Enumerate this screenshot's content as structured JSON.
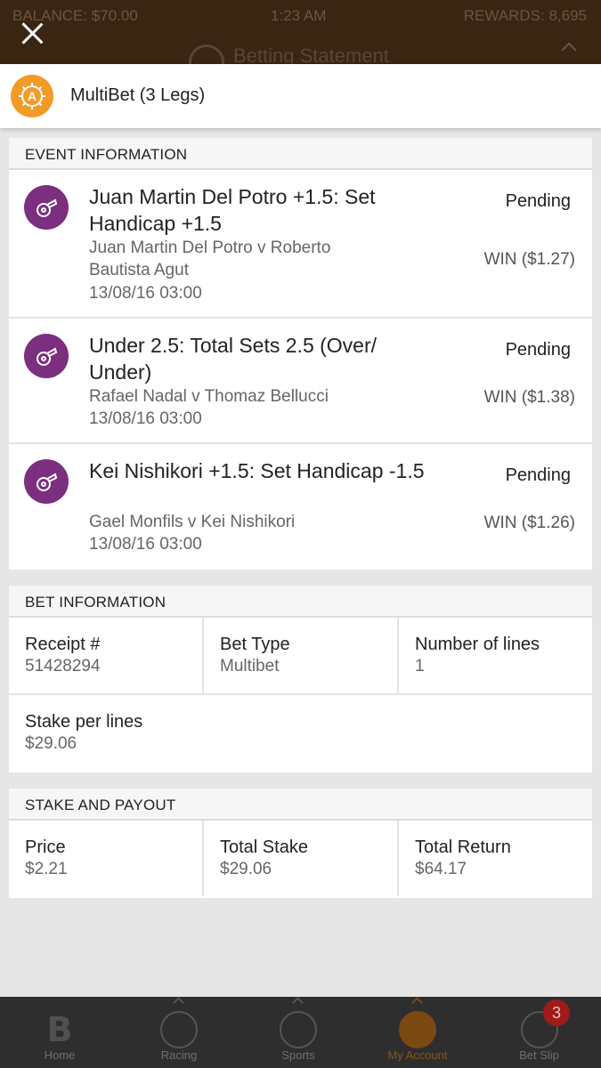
{
  "status_bar": {
    "balance": "BALANCE: $70.00",
    "time": "1:23 AM",
    "rewards": "REWARDS: 8,695"
  },
  "background_title": "Betting Statement",
  "header": {
    "title": "MultiBet (3 Legs)",
    "logo_letter": "A",
    "accent_color": "#f29b27"
  },
  "event_information": {
    "heading": "EVENT INFORMATION",
    "icon": "tennis-whistle-icon",
    "icon_color": "#7b2f7e",
    "legs": [
      {
        "selection": "Juan Martin Del Potro +1.5: Set Handicap +1.5",
        "match": "Juan Martin Del Potro v Roberto Bautista Agut",
        "date": "13/08/16 03:00",
        "status": "Pending",
        "win": "WIN ($1.27)"
      },
      {
        "selection": "Under 2.5: Total Sets 2.5 (Over/ Under)",
        "match": "Rafael Nadal v Thomaz Bellucci",
        "date": "13/08/16 03:00",
        "status": "Pending",
        "win": "WIN ($1.38)"
      },
      {
        "selection": "Kei Nishikori +1.5: Set Handicap -1.5",
        "match": "Gael Monfils v Kei Nishikori",
        "date": "13/08/16 03:00",
        "status": "Pending",
        "win": "WIN ($1.26)"
      }
    ]
  },
  "bet_information": {
    "heading": "BET INFORMATION",
    "receipt_label": "Receipt #",
    "receipt_value": "51428294",
    "bet_type_label": "Bet Type",
    "bet_type_value": "Multibet",
    "lines_label": "Number of lines",
    "lines_value": "1",
    "stake_per_lines_label": "Stake per lines",
    "stake_per_lines_value": "$29.06"
  },
  "stake_and_payout": {
    "heading": "STAKE AND PAYOUT",
    "price_label": "Price",
    "price_value": "$2.21",
    "total_stake_label": "Total Stake",
    "total_stake_value": "$29.06",
    "total_return_label": "Total Return",
    "total_return_value": "$64.17"
  },
  "bottom_nav": {
    "items": [
      {
        "label": "Home",
        "icon": "home-b-icon"
      },
      {
        "label": "Racing",
        "icon": "horse-icon"
      },
      {
        "label": "Sports",
        "icon": "football-icon"
      },
      {
        "label": "My Account",
        "icon": "account-icon",
        "active": true
      },
      {
        "label": "Bet Slip",
        "icon": "bet-slip-icon"
      }
    ],
    "bet_slip_badge": "3",
    "active_color": "#8a5515"
  }
}
